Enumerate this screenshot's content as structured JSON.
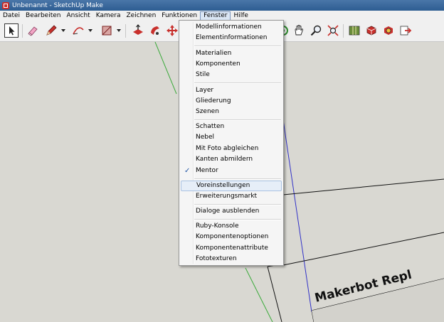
{
  "window": {
    "title": "Unbenannt - SketchUp Make"
  },
  "menubar": {
    "items": [
      {
        "label": "Datei"
      },
      {
        "label": "Bearbeiten"
      },
      {
        "label": "Ansicht"
      },
      {
        "label": "Kamera"
      },
      {
        "label": "Zeichnen"
      },
      {
        "label": "Funktionen"
      },
      {
        "label": "Fenster",
        "active": true
      },
      {
        "label": "Hilfe"
      }
    ]
  },
  "dropdown": {
    "items": [
      {
        "label": "Modellinformationen"
      },
      {
        "label": "Elementinformationen"
      },
      {
        "label": "Materialien"
      },
      {
        "label": "Komponenten"
      },
      {
        "label": "Stile"
      },
      {
        "label": "Layer"
      },
      {
        "label": "Gliederung"
      },
      {
        "label": "Szenen"
      },
      {
        "label": "Schatten"
      },
      {
        "label": "Nebel"
      },
      {
        "label": "Mit Foto abgleichen"
      },
      {
        "label": "Kanten abmildern"
      },
      {
        "label": "Mentor",
        "checked": true,
        "check_mark": "✓"
      },
      {
        "label": "Voreinstellungen",
        "highlighted": true
      },
      {
        "label": "Erweiterungsmarkt"
      },
      {
        "label": "Dialoge ausblenden"
      },
      {
        "label": "Ruby-Konsole"
      },
      {
        "label": "Komponentenoptionen"
      },
      {
        "label": "Komponentenattribute"
      },
      {
        "label": "Fototexturen"
      }
    ]
  },
  "viewport": {
    "model_label": "Makerbot Repl"
  },
  "colors": {
    "green_axis": "#3aa93a",
    "blue_axis": "#3232c8",
    "background": "#d9d8d2",
    "highlight": "#e6eef8"
  },
  "toolbar": {
    "tools": [
      "select-tool-icon",
      "eraser-tool-icon",
      "pencil-tool-icon",
      "arc-tool-icon",
      "rectangle-tool-icon",
      "push-pull-tool-icon",
      "follow-me-tool-icon",
      "move-tool-icon",
      "orbit-tool-icon",
      "pan-tool-icon",
      "zoom-tool-icon",
      "zoom-extents-tool-icon",
      "add-location-icon",
      "components-icon",
      "extension-warehouse-icon",
      "send-to-layout-icon"
    ]
  }
}
